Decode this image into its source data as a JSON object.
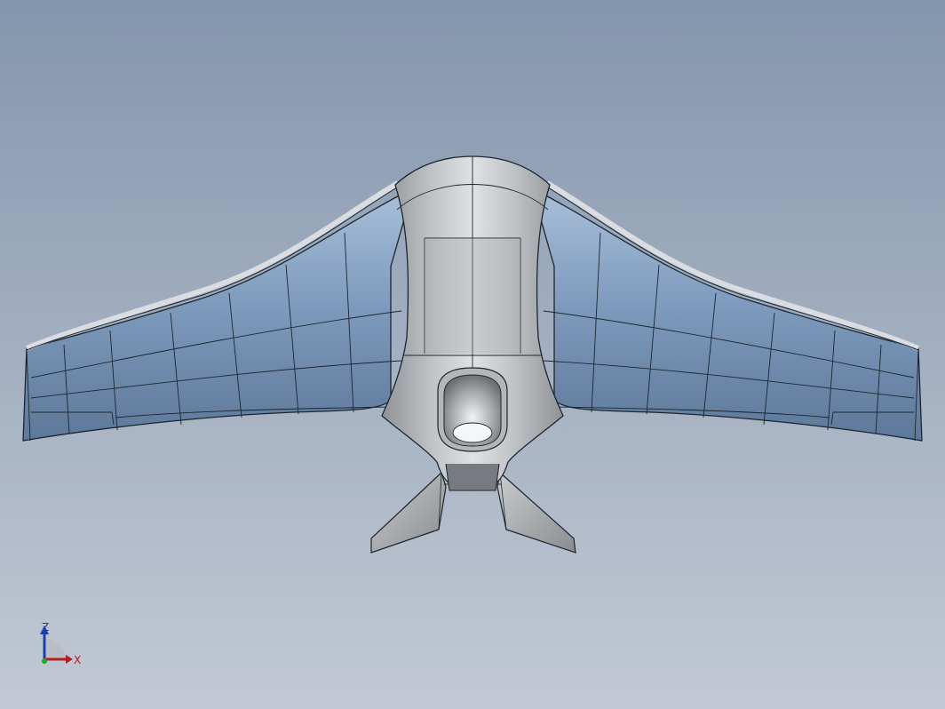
{
  "viewport": {
    "background_top": "#8496ad",
    "background_bottom": "#c2c9d4"
  },
  "model": {
    "wing_skin_color": "#7f9bbd",
    "body_color": "#bfc2c5",
    "edge_color": "#1c2630"
  },
  "triad": {
    "z_label": "Z",
    "x_label": "X",
    "z_color": "#1c3fb0",
    "x_color": "#b21e1e",
    "y_color": "#22a52a"
  }
}
